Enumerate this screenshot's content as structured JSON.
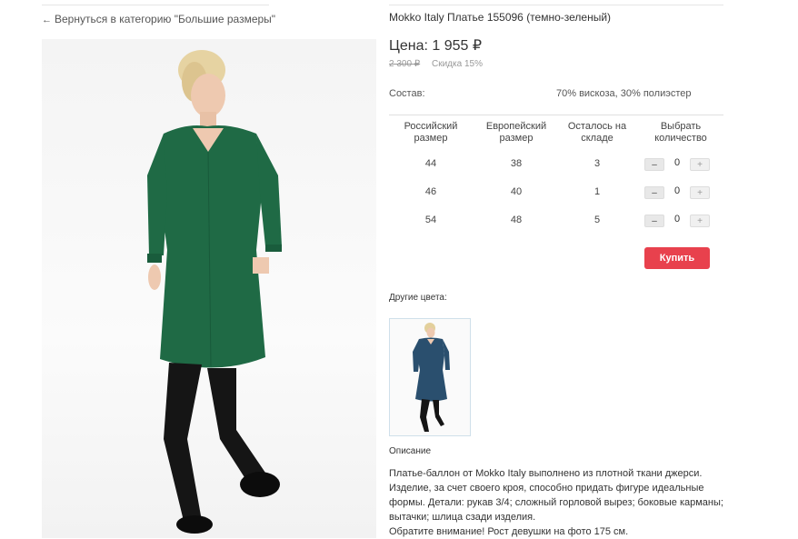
{
  "nav": {
    "back_label": "Вернуться в категорию \"Большие размеры\""
  },
  "product": {
    "title": "Mokko Italy Платье 155096 (темно-зеленый)",
    "price": "Цена: 1 955 ₽",
    "old_price": "2 300 ₽",
    "discount": "Скидка 15%",
    "composition_label": "Состав:",
    "composition_value": "70% вискоза, 30% полиэстер",
    "main_image": "woman-in-dark-green-dress-photo",
    "dress_color": "#1f6a45"
  },
  "size_table": {
    "headers": [
      "Российский размер",
      "Европейский размер",
      "Осталось на складе",
      "Выбрать количество"
    ],
    "rows": [
      {
        "ru": "44",
        "eu": "38",
        "stock": "3",
        "qty": "0"
      },
      {
        "ru": "46",
        "eu": "40",
        "stock": "1",
        "qty": "0"
      },
      {
        "ru": "54",
        "eu": "48",
        "stock": "5",
        "qty": "0"
      }
    ],
    "minus_symbol": "–",
    "plus_symbol": "+"
  },
  "buy_label": "Купить",
  "buy_color": "#e8414d",
  "other_colors": {
    "label": "Другие цвета:",
    "thumb_image": "woman-in-navy-dress-photo",
    "thumb_color": "#2a4f6e"
  },
  "description": {
    "title": "Описание",
    "text": "Платье-баллон от Mokko Italy выполнено из плотной ткани джерси. Изделие, за счет своего кроя, способно придать фигуре идеальные формы. Детали: рукав 3/4; сложный горловой вырез; боковые карманы; вытачки; шлица сзади изделия.",
    "note": "Обратите внимание! Рост девушки на фото 175 см."
  }
}
